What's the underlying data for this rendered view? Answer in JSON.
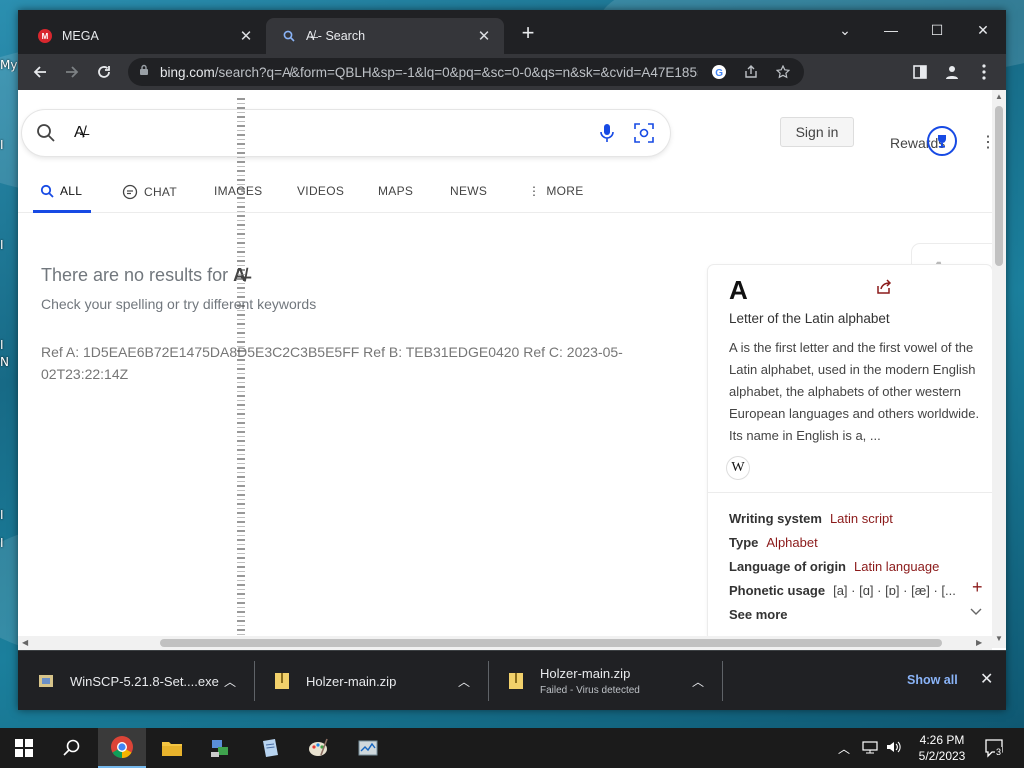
{
  "desktop": {
    "labels": [
      "My",
      "I",
      "I",
      "I",
      "N",
      "I",
      "I"
    ]
  },
  "browser": {
    "tabs": [
      {
        "title": "MEGA",
        "favicon": "mega-icon"
      },
      {
        "title": "A̸̶ - Search",
        "favicon": "bing-search-icon"
      }
    ],
    "omnibox": {
      "url_host": "bing.com",
      "url_rest": "/search?q=A̸&form=QBLH&sp=-1&lq=0&pq=&sc=0-0&qs=n&sk=&cvid=A47E185527064..."
    }
  },
  "page": {
    "search": {
      "query": "A̸̶",
      "signin_label": "Sign in",
      "rewards_label": "Rewards"
    },
    "nav": {
      "all": "ALL",
      "chat": "CHAT",
      "images": "IMAGES",
      "videos": "VIDEOS",
      "maps": "MAPS",
      "news": "NEWS",
      "more": "MORE"
    },
    "no_results_prefix": "There are no results for",
    "no_results_query": "A̸̶",
    "hint": "Check your spelling or try different keywords",
    "ref_text": "Ref A: 1D5EAE6B72E1475DA8D5E3C2C3B5E5FF Ref B: TEB31EDGE0420 Ref C: 2023-05-02T23:22:14Z",
    "knowledge_panel": {
      "letter": "A",
      "subtitle": "Letter of the Latin alphabet",
      "description": "A is the first letter and the first vowel of the Latin alphabet, used in the modern English alphabet, the alphabets of other western European languages and others worldwide. Its name in English is a, ...",
      "wiki_badge": "W",
      "facts": [
        {
          "key": "Writing system",
          "value": "Latin script"
        },
        {
          "key": "Type",
          "value": "Alphabet"
        },
        {
          "key": "Language of origin",
          "value": "Latin language"
        },
        {
          "key": "Phonetic usage",
          "value": "[a] · [ɑ] · [ɒ] · [æ] · [..."
        }
      ],
      "see_more": "See more",
      "cursive_sample": "A a"
    }
  },
  "downloads": {
    "items": [
      {
        "name": "WinSCP-5.21.8-Set....exe",
        "status": ""
      },
      {
        "name": "Holzer-main.zip",
        "status": ""
      },
      {
        "name": "Holzer-main.zip",
        "status": "Failed - Virus detected"
      }
    ],
    "show_all": "Show all"
  },
  "taskbar": {
    "time": "4:26 PM",
    "date": "5/2/2023",
    "notification_count": "3"
  },
  "colors": {
    "accent": "#174ae4",
    "error_link": "#8b1a1a",
    "chrome_dark": "#202124"
  }
}
